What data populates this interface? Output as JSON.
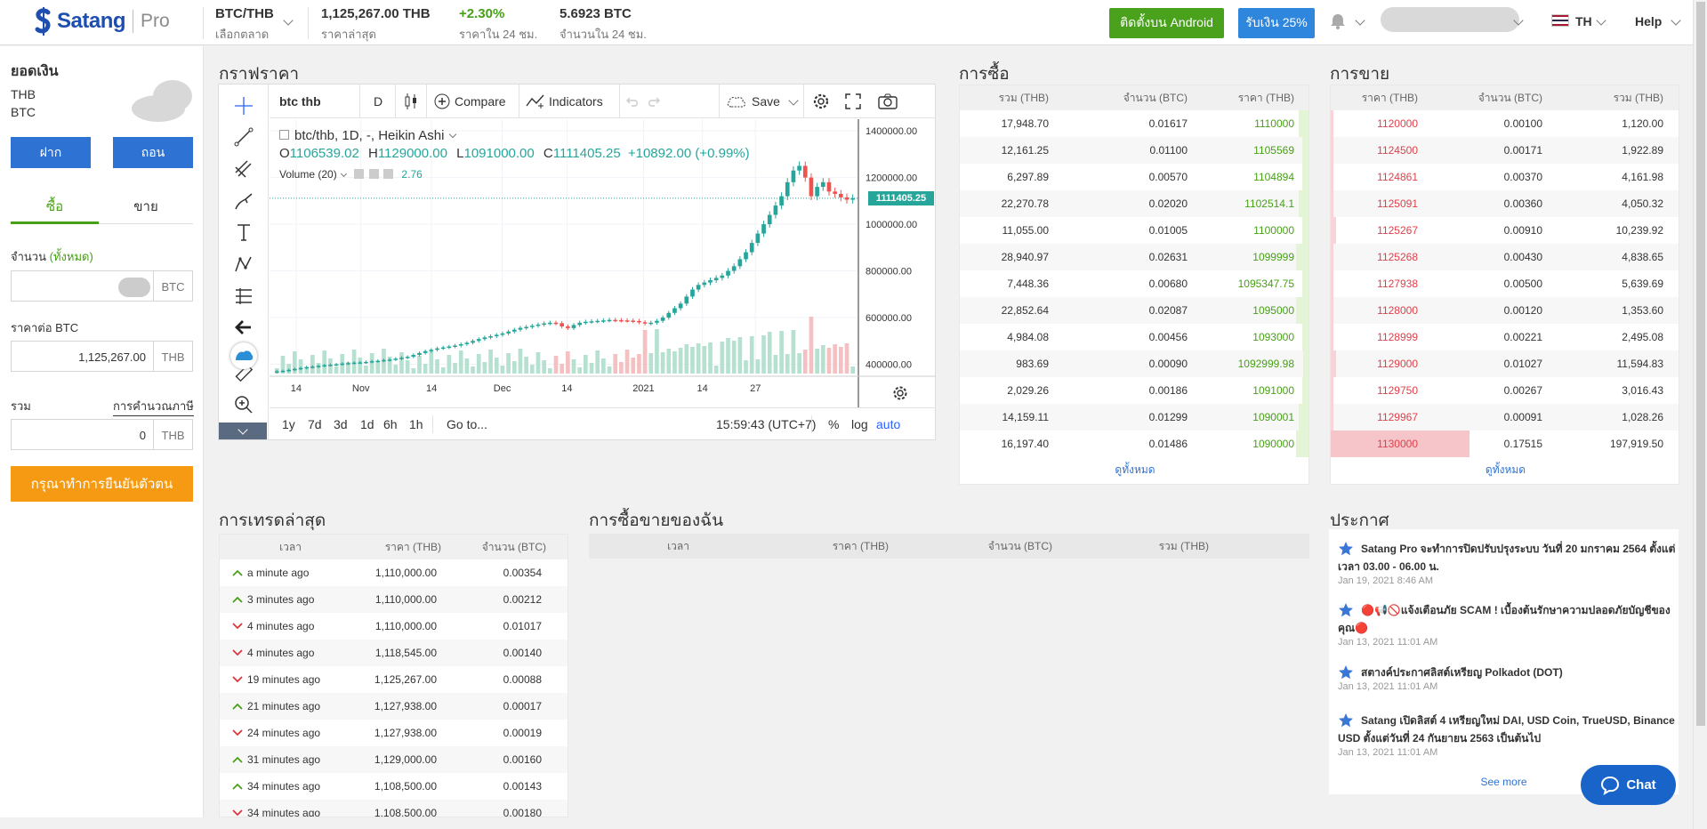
{
  "header": {
    "brand": "Satang",
    "brand_suffix": "Pro",
    "pair": "BTC/THB",
    "pair_label": "เลือกตลาด",
    "last_price": "1,125,267.00 THB",
    "last_price_label": "ราคาล่าสุด",
    "change_24h": "+2.30%",
    "change_24h_label": "ราคาใน 24 ชม.",
    "volume_24h": "5.6923 BTC",
    "volume_24h_label": "จำนวนใน 24 ชม.",
    "android_button": "ติดตั้งบน Android",
    "promo_button": "รับเงิน 25%",
    "language": "TH",
    "help": "Help",
    "accent_green": "#4aa21c",
    "accent_blue": "#2f86dd"
  },
  "balance": {
    "title": "ยอดเงิน",
    "currencies": [
      "THB",
      "BTC"
    ],
    "deposit": "ฝาก",
    "withdraw": "ถอน"
  },
  "order_form": {
    "tab_buy": "ซื้อ",
    "tab_sell": "ขาย",
    "amount_label": "จำนวน",
    "amount_all": "(ทั้งหมด)",
    "amount_unit": "BTC",
    "amount_value": "",
    "price_label": "ราคาต่อ BTC",
    "price_value": "1,125,267.00",
    "price_unit": "THB",
    "total_label": "รวม",
    "tax_link": "การคำนวณภาษี",
    "total_value": "0",
    "total_unit": "THB",
    "verify_button": "กรุณาทำการยืนยันตัวตน"
  },
  "chart_section": {
    "title": "กราฟราคา",
    "symbol": "btc thb",
    "interval": "D",
    "compare": "Compare",
    "indicators": "Indicators",
    "save": "Save",
    "legend": "btc/thb, 1D, -, Heikin Ashi",
    "ohlc_o": "1106539.02",
    "ohlc_h": "1129000.00",
    "ohlc_l": "1091000.00",
    "ohlc_c": "1111405.25",
    "ohlc_change": "+10892.00 (+0.99%)",
    "volume_label": "Volume (20)",
    "volume_value": "2.76",
    "price_tag": "1111405.25",
    "ranges": [
      "1y",
      "7d",
      "3d",
      "1d",
      "6h",
      "1h"
    ],
    "goto": "Go to...",
    "clock": "15:59:43 (UTC+7)",
    "pct": "%",
    "log": "log",
    "auto": "auto"
  },
  "chart_data": {
    "type": "candlestick",
    "x_ticks": [
      "14",
      "Nov",
      "14",
      "Dec",
      "14",
      "2021",
      "14",
      "27"
    ],
    "y_ticks": [
      400000,
      600000,
      800000,
      1000000,
      1200000,
      1400000
    ],
    "ylim": [
      360000,
      1450000
    ],
    "up_color": "#26a69a",
    "down_color": "#ef5350",
    "close_series": [
      370000,
      372000,
      376000,
      380000,
      384000,
      388000,
      390000,
      393000,
      396000,
      398000,
      400000,
      403000,
      405000,
      407000,
      408000,
      410000,
      413000,
      415000,
      418000,
      420000,
      424000,
      428000,
      432000,
      440000,
      448000,
      456000,
      462000,
      468000,
      472000,
      476000,
      480000,
      486000,
      492000,
      500000,
      508000,
      515000,
      520000,
      526000,
      532000,
      540000,
      548000,
      556000,
      560000,
      565000,
      570000,
      575000,
      578000,
      576000,
      562000,
      555000,
      568000,
      578000,
      582000,
      584000,
      586000,
      588000,
      590000,
      589000,
      588000,
      587000,
      585000,
      580000,
      575000,
      578000,
      586000,
      600000,
      620000,
      640000,
      660000,
      690000,
      720000,
      740000,
      750000,
      760000,
      770000,
      780000,
      800000,
      820000,
      850000,
      880000,
      920000,
      960000,
      1000000,
      1040000,
      1080000,
      1120000,
      1180000,
      1230000,
      1250000,
      1200000,
      1120000,
      1160000,
      1180000,
      1140000,
      1130000,
      1115000,
      1105000,
      1111405
    ]
  },
  "buy_book": {
    "title": "การซื้อ",
    "headers": [
      "รวม (THB)",
      "จำนวน (BTC)",
      "ราคา (THB)"
    ],
    "rows": [
      [
        "17,948.70",
        "0.01617",
        "1110000",
        0.03
      ],
      [
        "12,161.25",
        "0.01100",
        "1105569",
        0.02
      ],
      [
        "6,297.89",
        "0.00570",
        "1104894",
        0.02
      ],
      [
        "22,270.78",
        "0.02020",
        "1102514.1",
        0.03
      ],
      [
        "11,055.00",
        "0.01005",
        "1100000",
        0.02
      ],
      [
        "28,940.97",
        "0.02631",
        "1099999",
        0.04
      ],
      [
        "7,448.36",
        "0.00680",
        "1095347.75",
        0.02
      ],
      [
        "22,852.64",
        "0.02087",
        "1095000",
        0.04
      ],
      [
        "4,984.08",
        "0.00456",
        "1093000",
        0.02
      ],
      [
        "983.69",
        "0.00090",
        "1092999.98",
        0.01
      ],
      [
        "2,029.26",
        "0.00186",
        "1091000",
        0.02
      ],
      [
        "14,159.11",
        "0.01299",
        "1090001",
        0.03
      ],
      [
        "16,197.40",
        "0.01486",
        "1090000",
        0.04
      ]
    ],
    "see_all": "ดูทั้งหมด"
  },
  "sell_book": {
    "title": "การขาย",
    "headers": [
      "ราคา (THB)",
      "จำนวน (BTC)",
      "รวม (THB)"
    ],
    "rows": [
      [
        "1120000",
        "0.00100",
        "1,120.00",
        0.0
      ],
      [
        "1124500",
        "0.00171",
        "1,922.89",
        0.0
      ],
      [
        "1124861",
        "0.00370",
        "4,161.98",
        0.01
      ],
      [
        "1125091",
        "0.00360",
        "4,050.32",
        0.01
      ],
      [
        "1125267",
        "0.00910",
        "10,239.92",
        0.04
      ],
      [
        "1125268",
        "0.00430",
        "4,838.65",
        0.01
      ],
      [
        "1127938",
        "0.00500",
        "5,639.69",
        0.02
      ],
      [
        "1128000",
        "0.00120",
        "1,353.60",
        0.0
      ],
      [
        "1128999",
        "0.00221",
        "2,495.08",
        0.0
      ],
      [
        "1129000",
        "0.01027",
        "11,594.83",
        0.04
      ],
      [
        "1129750",
        "0.00267",
        "3,016.43",
        0.01
      ],
      [
        "1129967",
        "0.00091",
        "1,028.26",
        0.0
      ],
      [
        "1130000",
        "0.17515",
        "197,919.50",
        1.0
      ]
    ],
    "see_all": "ดูทั้งหมด"
  },
  "recent_trades": {
    "title": "การเทรดล่าสุด",
    "headers": [
      "เวลา",
      "ราคา (THB)",
      "จำนวน (BTC)"
    ],
    "rows": [
      [
        "up",
        "a minute ago",
        "1,110,000.00",
        "0.00354"
      ],
      [
        "up",
        "3 minutes ago",
        "1,110,000.00",
        "0.00212"
      ],
      [
        "down",
        "4 minutes ago",
        "1,110,000.00",
        "0.01017"
      ],
      [
        "down",
        "4 minutes ago",
        "1,118,545.00",
        "0.00140"
      ],
      [
        "down",
        "19 minutes ago",
        "1,125,267.00",
        "0.00088"
      ],
      [
        "up",
        "21 minutes ago",
        "1,127,938.00",
        "0.00017"
      ],
      [
        "down",
        "24 minutes ago",
        "1,127,938.00",
        "0.00019"
      ],
      [
        "up",
        "31 minutes ago",
        "1,129,000.00",
        "0.00160"
      ],
      [
        "up",
        "34 minutes ago",
        "1,108,500.00",
        "0.00143"
      ],
      [
        "down",
        "34 minutes ago",
        "1,108,500.00",
        "0.00180"
      ]
    ]
  },
  "my_orders": {
    "title": "การซื้อขายของฉัน",
    "headers": [
      "เวลา",
      "ราคา (THB)",
      "จำนวน (BTC)",
      "รวม (THB)"
    ]
  },
  "announcements": {
    "title": "ประกาศ",
    "items": [
      {
        "text": "Satang Pro จะทำการปิดปรับปรุงระบบ วันที่ 20 มกราคม 2564 ตั้งแต่เวลา 03.00 - 06.00 น.",
        "date": "Jan 19, 2021 8:46 AM"
      },
      {
        "text": "🔴📢🚫แจ้งเตือนภัย SCAM ! เบื้องต้นรักษาความปลอดภัยบัญชีของคุณ🔴",
        "date": "Jan 13, 2021 11:01 AM"
      },
      {
        "text": "สตางค์ประกาศลิสต์เหรียญ Polkadot (DOT)",
        "date": "Jan 13, 2021 11:01 AM"
      },
      {
        "text": "Satang เปิดลิสต์ 4 เหรียญใหม่ DAI, USD Coin, TrueUSD, Binance USD ตั้งแต่วันที่ 24 กันยายน 2563 เป็นต้นไป",
        "date": "Jan 13, 2021 11:01 AM"
      }
    ],
    "see_more": "See more"
  },
  "chat_button": "Chat"
}
